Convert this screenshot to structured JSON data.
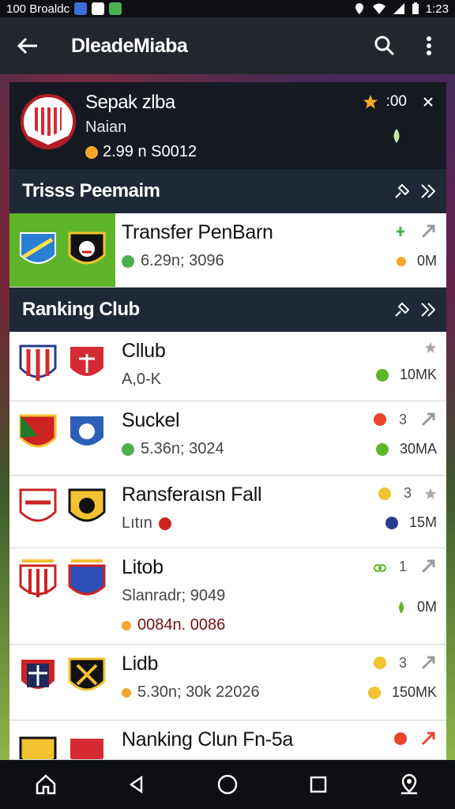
{
  "status_bar": {
    "left_text": "100 Broaldc",
    "time": "1:23"
  },
  "app_bar": {
    "title": "DleadeMiaba"
  },
  "profile": {
    "name": "Sepak zlba",
    "subtitle": "Naian",
    "stat": "2.99 n S0012",
    "rating": ":00"
  },
  "transfer_section": {
    "header": "Trisss Peemaim",
    "row": {
      "name": "Transfer PenBarn",
      "sub": "6.29n; 3096",
      "value": "0M"
    }
  },
  "ranking_section": {
    "header": "Ranking Club",
    "rows": [
      {
        "name": "Cllub",
        "sub": "A,0-K",
        "value": "10MK",
        "rank": ""
      },
      {
        "name": "Suckel",
        "sub": "5.36n; 3024",
        "value": "30MA",
        "rank": "3"
      },
      {
        "name": "Ransferaısn Fall",
        "sub": "Lıtın",
        "value": "15M",
        "rank": "3"
      },
      {
        "name": "Litob",
        "sub": "Slanradr; 9049",
        "sub2": "0084n. 0086",
        "value": "0M",
        "rank": "1"
      },
      {
        "name": "Lidb",
        "sub": "5.30n; 30k 22026",
        "value": "150MK",
        "rank": "3"
      },
      {
        "name": "Nanking Clun Fn-5a",
        "sub": "",
        "value": "",
        "rank": ""
      }
    ]
  },
  "colors": {
    "accent_green": "#5fb52a",
    "header_bg": "#1e2836",
    "star": "#f4a72a"
  },
  "icons": [
    "back-arrow-icon",
    "search-icon",
    "more-vert-icon",
    "star-icon",
    "close-icon",
    "pin-icon",
    "chevron-double-icon",
    "home-icon",
    "back-nav-icon",
    "circle-home-icon",
    "square-recents-icon",
    "map-pin-icon"
  ]
}
